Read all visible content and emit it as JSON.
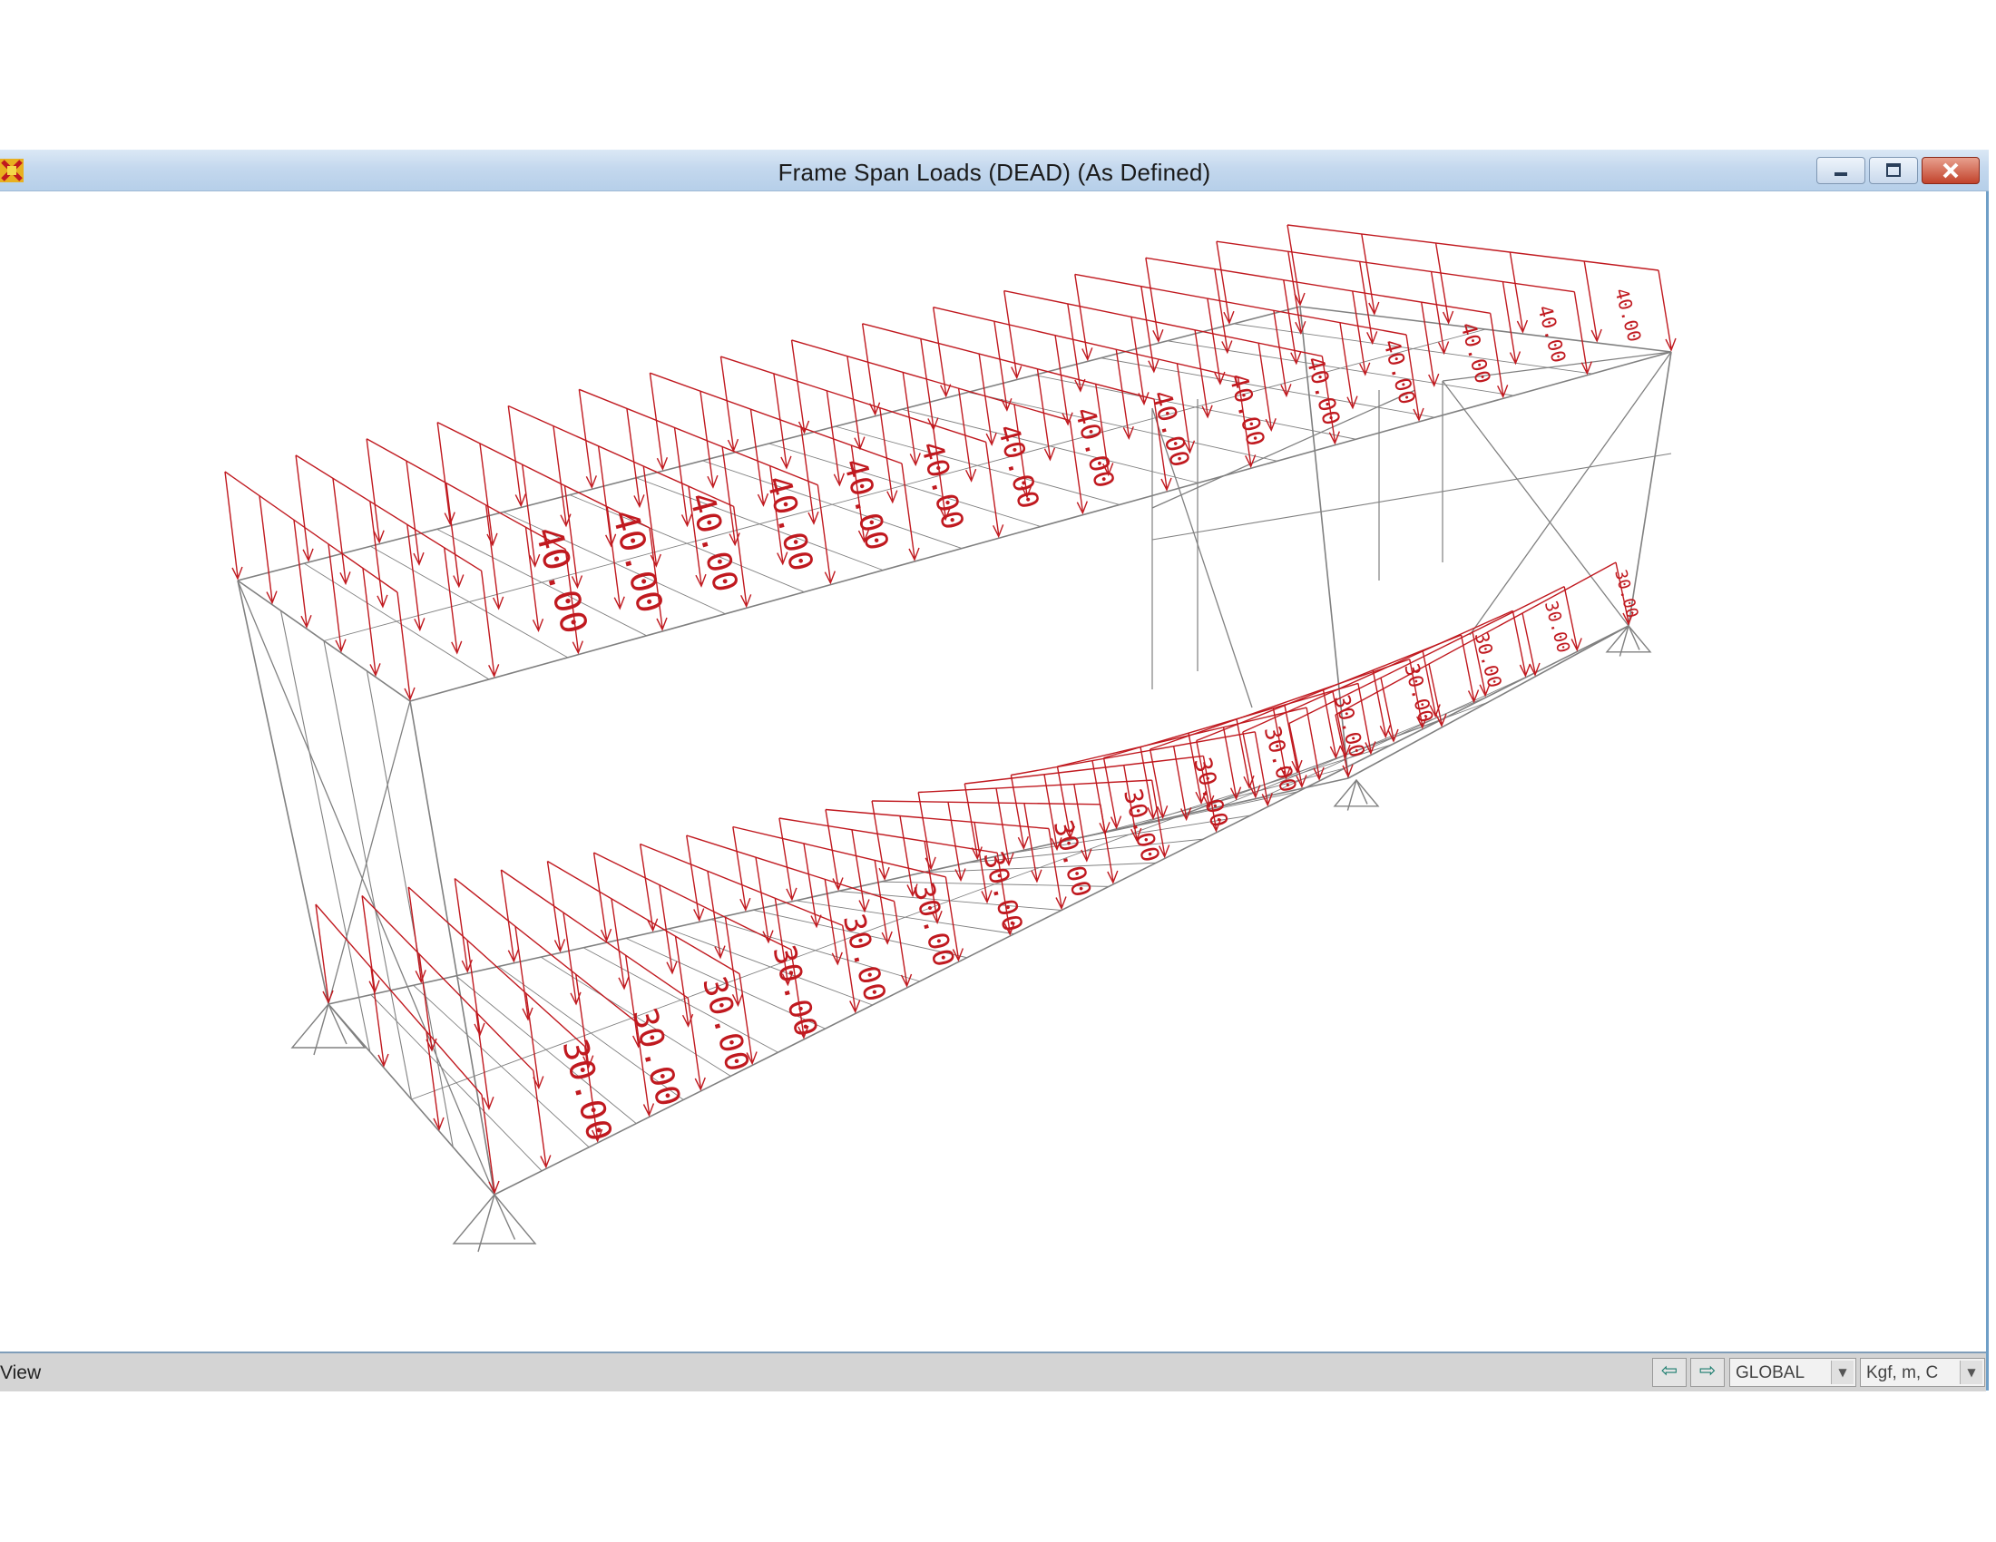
{
  "window": {
    "title": "Frame Span Loads (DEAD) (As Defined)"
  },
  "icons": {
    "app": "sap2000-app-icon",
    "minimize": "minimize-icon",
    "maximize": "maximize-icon",
    "close": "close-icon",
    "prev_view": "arrow-left-icon",
    "next_view": "arrow-right-icon",
    "support": "pin-support-icon"
  },
  "colors": {
    "load_arrow": "#c0191f",
    "frame_line": "#808080"
  },
  "loads": {
    "upper_value": "40.00",
    "lower_value": "30.00",
    "upper_label_count": 15,
    "lower_label_count": 16
  },
  "statusbar": {
    "text": "View",
    "coord_system": "GLOBAL",
    "units": "Kgf, m, C"
  }
}
